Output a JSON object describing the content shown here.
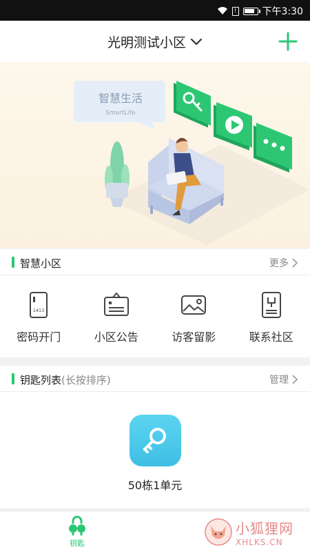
{
  "status_bar": {
    "time": "下午3:30",
    "battery_level": 0.85
  },
  "header": {
    "community_name": "光明测试小区"
  },
  "banner": {
    "card_title": "智慧生活",
    "card_subtitle": "SmartLife"
  },
  "smart_section": {
    "title": "智慧小区",
    "more_label": "更多",
    "features": [
      {
        "label": "密码开门",
        "icon": "password-door-icon"
      },
      {
        "label": "小区公告",
        "icon": "notice-board-icon"
      },
      {
        "label": "访客留影",
        "icon": "visitor-photo-icon"
      },
      {
        "label": "联系社区",
        "icon": "contact-community-icon"
      }
    ]
  },
  "keys_section": {
    "title": "钥匙列表",
    "subtitle": "(长按排序)",
    "manage_label": "管理",
    "keys": [
      {
        "label": "50栋1单元"
      }
    ]
  },
  "bottom_nav": {
    "tabs": [
      {
        "label": "钥匙",
        "active": true
      }
    ]
  },
  "watermark": {
    "line1": "小狐狸网",
    "line2": "XHLKS.CN"
  },
  "colors": {
    "accent": "#2dc774",
    "key_button": "#4cc9ec",
    "banner_bg": "#fbf3e3"
  }
}
